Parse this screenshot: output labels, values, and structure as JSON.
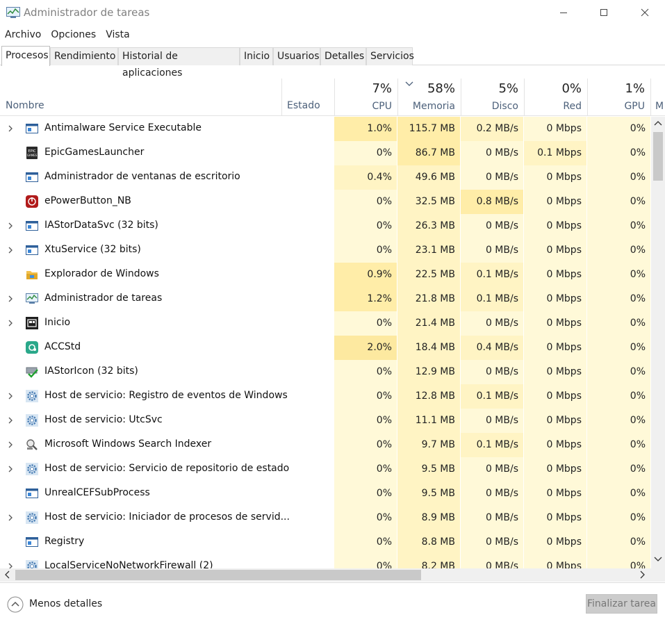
{
  "window": {
    "title": "Administrador de tareas"
  },
  "menu": [
    "Archivo",
    "Opciones",
    "Vista"
  ],
  "tabs": [
    "Procesos",
    "Rendimiento",
    "Historial de aplicaciones",
    "Inicio",
    "Usuarios",
    "Detalles",
    "Servicios"
  ],
  "header": {
    "name": "Nombre",
    "status": "Estado",
    "cpu": {
      "pct": "7%",
      "label": "CPU"
    },
    "memory": {
      "pct": "58%",
      "label": "Memoria"
    },
    "disk": {
      "pct": "5%",
      "label": "Disco"
    },
    "network": {
      "pct": "0%",
      "label": "Red"
    },
    "gpu": {
      "pct": "1%",
      "label": "GPU"
    },
    "next": "M"
  },
  "processes": [
    {
      "name": "Antimalware Service Executable",
      "icon": "window-icon",
      "expandable": true,
      "cpu": "1.0%",
      "mem": "115.7 MB",
      "disk": "0.2 MB/s",
      "net": "0 Mbps",
      "gpu": "0%"
    },
    {
      "name": "EpicGamesLauncher",
      "icon": "epic-games-icon",
      "expandable": false,
      "cpu": "0%",
      "mem": "86.7 MB",
      "disk": "0 MB/s",
      "net": "0.1 Mbps",
      "gpu": "0%"
    },
    {
      "name": "Administrador de ventanas de escritorio",
      "icon": "window-icon",
      "expandable": false,
      "cpu": "0.4%",
      "mem": "49.6 MB",
      "disk": "0 MB/s",
      "net": "0 Mbps",
      "gpu": "0%"
    },
    {
      "name": "ePowerButton_NB",
      "icon": "power-button-icon",
      "expandable": false,
      "cpu": "0%",
      "mem": "32.5 MB",
      "disk": "0.8 MB/s",
      "net": "0 Mbps",
      "gpu": "0%"
    },
    {
      "name": "IAStorDataSvc (32 bits)",
      "icon": "window-icon",
      "expandable": true,
      "cpu": "0%",
      "mem": "26.3 MB",
      "disk": "0 MB/s",
      "net": "0 Mbps",
      "gpu": "0%"
    },
    {
      "name": "XtuService (32 bits)",
      "icon": "window-icon",
      "expandable": true,
      "cpu": "0%",
      "mem": "23.1 MB",
      "disk": "0 MB/s",
      "net": "0 Mbps",
      "gpu": "0%"
    },
    {
      "name": "Explorador de Windows",
      "icon": "folder-icon",
      "expandable": false,
      "cpu": "0.9%",
      "mem": "22.5 MB",
      "disk": "0.1 MB/s",
      "net": "0 Mbps",
      "gpu": "0%"
    },
    {
      "name": "Administrador de tareas",
      "icon": "task-manager-icon",
      "expandable": true,
      "cpu": "1.2%",
      "mem": "21.8 MB",
      "disk": "0.1 MB/s",
      "net": "0 Mbps",
      "gpu": "0%"
    },
    {
      "name": "Inicio",
      "icon": "start-icon",
      "expandable": true,
      "cpu": "0%",
      "mem": "21.4 MB",
      "disk": "0 MB/s",
      "net": "0 Mbps",
      "gpu": "0%"
    },
    {
      "name": "ACCStd",
      "icon": "acc-icon",
      "expandable": false,
      "cpu": "2.0%",
      "mem": "18.4 MB",
      "disk": "0.4 MB/s",
      "net": "0 Mbps",
      "gpu": "0%"
    },
    {
      "name": "IAStorIcon (32 bits)",
      "icon": "storage-check-icon",
      "expandable": false,
      "cpu": "0%",
      "mem": "12.9 MB",
      "disk": "0 MB/s",
      "net": "0 Mbps",
      "gpu": "0%"
    },
    {
      "name": "Host de servicio: Registro de eventos de Windows",
      "icon": "gear-icon",
      "expandable": true,
      "cpu": "0%",
      "mem": "12.8 MB",
      "disk": "0.1 MB/s",
      "net": "0 Mbps",
      "gpu": "0%"
    },
    {
      "name": "Host de servicio: UtcSvc",
      "icon": "gear-icon",
      "expandable": true,
      "cpu": "0%",
      "mem": "11.1 MB",
      "disk": "0 MB/s",
      "net": "0 Mbps",
      "gpu": "0%"
    },
    {
      "name": "Microsoft Windows Search Indexer",
      "icon": "search-indexer-icon",
      "expandable": true,
      "cpu": "0%",
      "mem": "9.7 MB",
      "disk": "0.1 MB/s",
      "net": "0 Mbps",
      "gpu": "0%"
    },
    {
      "name": "Host de servicio: Servicio de repositorio de estado",
      "icon": "gear-icon",
      "expandable": true,
      "cpu": "0%",
      "mem": "9.5 MB",
      "disk": "0 MB/s",
      "net": "0 Mbps",
      "gpu": "0%"
    },
    {
      "name": "UnrealCEFSubProcess",
      "icon": "window-icon",
      "expandable": false,
      "cpu": "0%",
      "mem": "9.5 MB",
      "disk": "0 MB/s",
      "net": "0 Mbps",
      "gpu": "0%"
    },
    {
      "name": "Host de servicio: Iniciador de procesos de servid...",
      "icon": "gear-icon",
      "expandable": true,
      "cpu": "0%",
      "mem": "8.9 MB",
      "disk": "0 MB/s",
      "net": "0 Mbps",
      "gpu": "0%"
    },
    {
      "name": "Registry",
      "icon": "window-icon",
      "expandable": false,
      "cpu": "0%",
      "mem": "8.8 MB",
      "disk": "0 MB/s",
      "net": "0 Mbps",
      "gpu": "0%"
    },
    {
      "name": "LocalServiceNoNetworkFirewall (2)",
      "icon": "gear-icon",
      "expandable": true,
      "cpu": "0%",
      "mem": "8.2 MB",
      "disk": "0 MB/s",
      "net": "0 Mbps",
      "gpu": "0%"
    }
  ],
  "footer": {
    "less_details": "Menos detalles",
    "end_task": "Finalizar tarea"
  },
  "colors": {
    "heat_low": "#fff9d8",
    "heat_mid": "#fff4c4",
    "heat_high": "#ffeda8",
    "header_label": "#4c607a"
  }
}
